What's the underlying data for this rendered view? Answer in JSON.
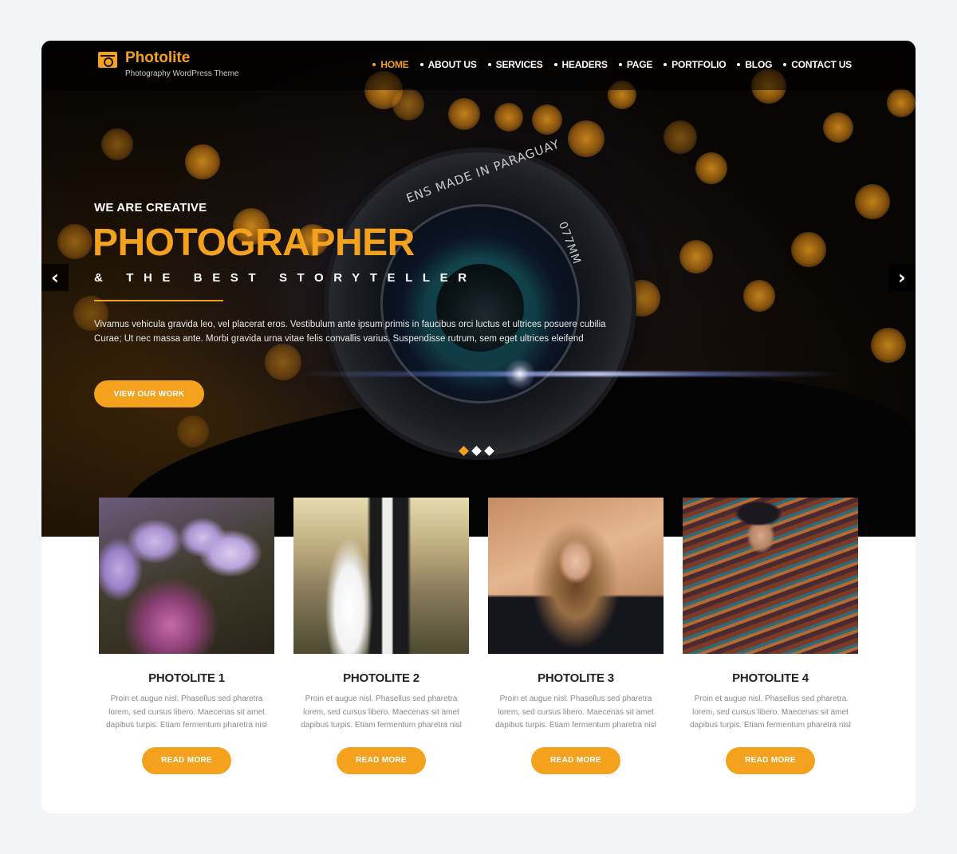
{
  "brand": {
    "name": "Photolite",
    "tagline": "Photography WordPress Theme",
    "logo_icon": "camera-icon",
    "accent_color": "#f4a21e"
  },
  "nav": {
    "items": [
      {
        "label": "HOME",
        "active": true
      },
      {
        "label": "ABOUT US",
        "active": false
      },
      {
        "label": "SERVICES",
        "active": false
      },
      {
        "label": "HEADERS",
        "active": false
      },
      {
        "label": "PAGE",
        "active": false
      },
      {
        "label": "PORTFOLIO",
        "active": false
      },
      {
        "label": "BLOG",
        "active": false
      },
      {
        "label": "CONTACT US",
        "active": false
      }
    ]
  },
  "hero": {
    "kicker": "WE ARE CREATIVE",
    "title": "PHOTOGRAPHER",
    "tagline": "& THE BEST STORYTELLER",
    "body": "Vivamus vehicula gravida leo, vel placerat eros. Vestibulum ante ipsum primis in faucibus orci luctus et ultrices posuere cubilia Curae; Ut nec massa ante. Morbi gravida urna vitae felis convallis varius. Suspendisse rutrum, sem eget ultrices eleifend",
    "button_label": "VIEW OUR WORK",
    "lens_text_top": "ENS MADE IN PARAGUAY",
    "lens_text_side": "077MM",
    "prev_icon": "chevron-left-icon",
    "next_icon": "chevron-right-icon",
    "prev_glyph": "‹",
    "next_glyph": "›",
    "slides_total": 3,
    "slide_active": 1
  },
  "cards": [
    {
      "title": "PHOTOLITE 1",
      "image": "purple-flowers-photo",
      "body": "Proin et augue nisl. Phasellus sed pharetra lorem, sed cursus libero. Maecenas sit amet dapibus turpis. Etiam fermentum pharetra nisl",
      "button_label": "READ MORE"
    },
    {
      "title": "PHOTOLITE 2",
      "image": "wedding-couple-photo",
      "body": "Proin et augue nisl. Phasellus sed pharetra lorem, sed cursus libero. Maecenas sit amet dapibus turpis. Etiam fermentum pharetra nisl",
      "button_label": "READ MORE"
    },
    {
      "title": "PHOTOLITE 3",
      "image": "woman-portrait-photo",
      "body": "Proin et augue nisl. Phasellus sed pharetra lorem, sed cursus libero. Maecenas sit amet dapibus turpis. Etiam fermentum pharetra nisl",
      "button_label": "READ MORE"
    },
    {
      "title": "PHOTOLITE 4",
      "image": "woman-hat-fashion-photo",
      "body": "Proin et augue nisl. Phasellus sed pharetra lorem, sed cursus libero. Maecenas sit amet dapibus turpis. Etiam fermentum pharetra nisl",
      "button_label": "READ MORE"
    }
  ]
}
